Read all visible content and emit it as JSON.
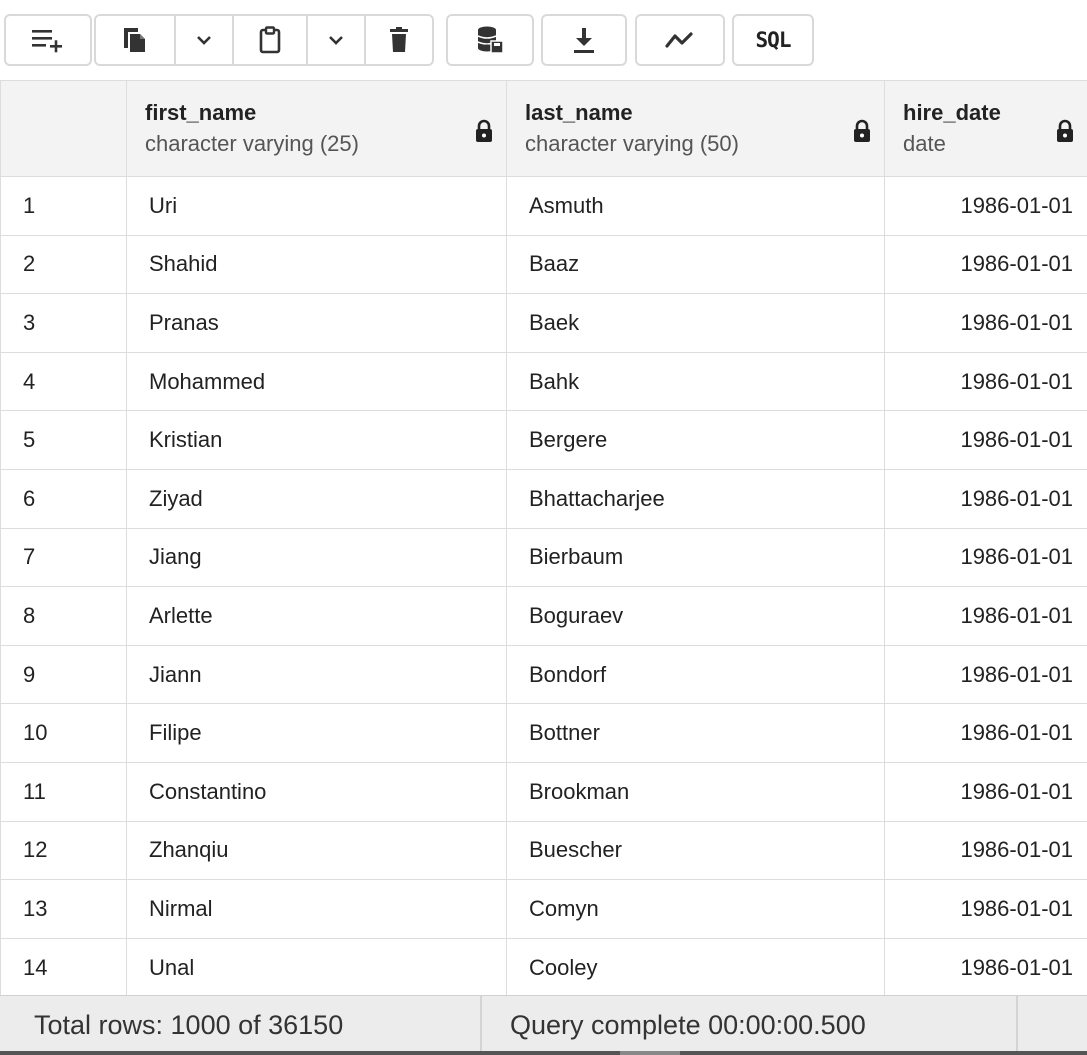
{
  "toolbar": {
    "sql_label": "SQL",
    "icons": [
      "add-row-icon",
      "copy-icon",
      "chevron-down-icon",
      "paste-icon",
      "chevron-down-icon",
      "delete-icon",
      "save-data-icon",
      "download-icon",
      "graph-icon",
      "sql-icon"
    ]
  },
  "grid": {
    "columns": [
      {
        "name": "first_name",
        "type": "character varying (25)"
      },
      {
        "name": "last_name",
        "type": "character varying (50)"
      },
      {
        "name": "hire_date",
        "type": "date"
      }
    ],
    "rows": [
      {
        "num": "1",
        "first_name": "Uri",
        "last_name": "Asmuth",
        "hire_date": "1986-01-01"
      },
      {
        "num": "2",
        "first_name": "Shahid",
        "last_name": "Baaz",
        "hire_date": "1986-01-01"
      },
      {
        "num": "3",
        "first_name": "Pranas",
        "last_name": "Baek",
        "hire_date": "1986-01-01"
      },
      {
        "num": "4",
        "first_name": "Mohammed",
        "last_name": "Bahk",
        "hire_date": "1986-01-01"
      },
      {
        "num": "5",
        "first_name": "Kristian",
        "last_name": "Bergere",
        "hire_date": "1986-01-01"
      },
      {
        "num": "6",
        "first_name": "Ziyad",
        "last_name": "Bhattacharjee",
        "hire_date": "1986-01-01"
      },
      {
        "num": "7",
        "first_name": "Jiang",
        "last_name": "Bierbaum",
        "hire_date": "1986-01-01"
      },
      {
        "num": "8",
        "first_name": "Arlette",
        "last_name": "Boguraev",
        "hire_date": "1986-01-01"
      },
      {
        "num": "9",
        "first_name": "Jiann",
        "last_name": "Bondorf",
        "hire_date": "1986-01-01"
      },
      {
        "num": "10",
        "first_name": "Filipe",
        "last_name": "Bottner",
        "hire_date": "1986-01-01"
      },
      {
        "num": "11",
        "first_name": "Constantino",
        "last_name": "Brookman",
        "hire_date": "1986-01-01"
      },
      {
        "num": "12",
        "first_name": "Zhanqiu",
        "last_name": "Buescher",
        "hire_date": "1986-01-01"
      },
      {
        "num": "13",
        "first_name": "Nirmal",
        "last_name": "Comyn",
        "hire_date": "1986-01-01"
      },
      {
        "num": "14",
        "first_name": "Unal",
        "last_name": "Cooley",
        "hire_date": "1986-01-01"
      }
    ]
  },
  "status": {
    "total_rows": "Total rows: 1000 of 36150",
    "query_status": "Query complete 00:00:00.500"
  },
  "colors": {
    "header_bg": "#f3f3f3",
    "border": "#dddddd",
    "status_bg": "#ececec"
  }
}
